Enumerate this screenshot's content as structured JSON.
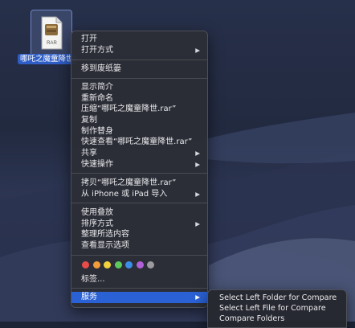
{
  "desktop": {
    "file_name": "哪吒之魔童降世",
    "file_icon_text": "RAR"
  },
  "context_menu": {
    "open": "打开",
    "open_with": "打开方式",
    "move_to_trash": "移到废纸篓",
    "get_info": "显示简介",
    "rename": "重新命名",
    "compress": "压缩“哪吒之魔童降世.rar”",
    "duplicate": "复制",
    "make_alias": "制作替身",
    "quick_look": "快速查看“哪吒之魔童降世.rar”",
    "share": "共享",
    "quick_actions": "快速操作",
    "copy_item": "拷贝“哪吒之魔童降世.rar”",
    "import_from_iphone": "从 iPhone 或 iPad 导入",
    "use_stacks": "使用叠放",
    "sort_by": "排序方式",
    "clean_up_selection": "整理所选内容",
    "show_view_options": "查看显示选项",
    "tags_label": "标签...",
    "services": "服务"
  },
  "tag_colors": [
    "#e94b4b",
    "#f39a3a",
    "#f2d23b",
    "#5cc95c",
    "#3a8ee8",
    "#b060d8",
    "#9a9aa0"
  ],
  "services_submenu": {
    "items": [
      "Select Left Folder for Compare",
      "Select Left File for Compare",
      "Compare Folders"
    ]
  },
  "colors": {
    "accent": "#2a61d4",
    "menu_bg": "#2c2e36"
  }
}
